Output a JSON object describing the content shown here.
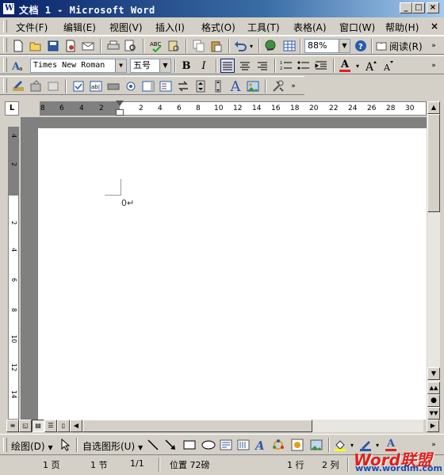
{
  "window": {
    "title": "文档 1 - Microsoft Word",
    "icon_letter": "W",
    "controls": [
      "_",
      "□",
      "×"
    ]
  },
  "menu": {
    "items": [
      "文件(F)",
      "编辑(E)",
      "视图(V)",
      "插入(I)",
      "格式(O)",
      "工具(T)",
      "表格(A)",
      "窗口(W)",
      "帮助(H)"
    ],
    "close_label": "×"
  },
  "standard_toolbar": {
    "zoom": "88%",
    "read_label": "阅读(R)"
  },
  "format_toolbar": {
    "font_name": "Times New Roman",
    "font_size": "五号",
    "bold": "B",
    "italic": "I",
    "font_color_letter": "A"
  },
  "ruler": {
    "ticks": [
      "8",
      "6",
      "4",
      "2",
      "2",
      "4",
      "6",
      "8",
      "10",
      "12",
      "14",
      "16",
      "18",
      "20",
      "22",
      "24",
      "26",
      "28",
      "30"
    ]
  },
  "vertical_ruler": {
    "ticks": [
      "4",
      "2",
      "2",
      "4",
      "6",
      "8",
      "10",
      "12",
      "14"
    ]
  },
  "document": {
    "paragraph_mark": "0↵"
  },
  "draw_toolbar": {
    "draw_label": "绘图(D)",
    "autoshape_label": "自选图形(U)"
  },
  "status": {
    "page": "1 页",
    "section": "1 节",
    "page_of": "1/1",
    "position": "位置 72磅",
    "line": "1 行",
    "column": "2 列"
  },
  "watermark": {
    "brand": "Word联盟",
    "url": "www.wordlm.com"
  }
}
